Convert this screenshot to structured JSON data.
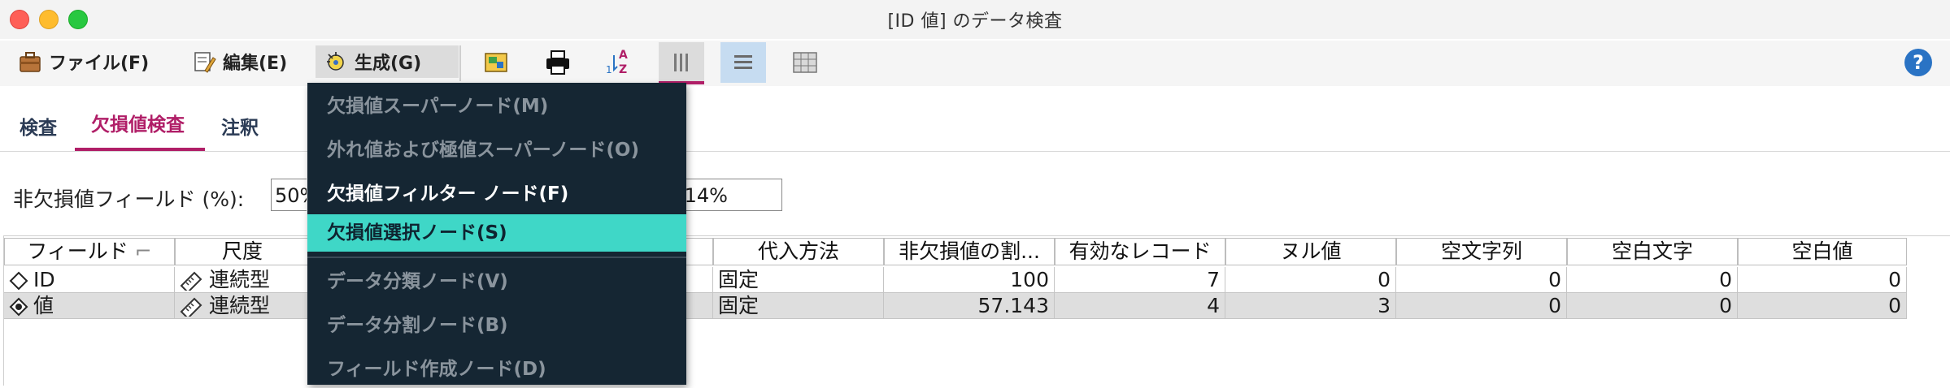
{
  "window": {
    "title": "[ID 値] のデータ検査"
  },
  "menubar": {
    "items": [
      {
        "label": "ファイル(F)",
        "icon": "briefcase-icon"
      },
      {
        "label": "編集(E)",
        "icon": "edit-icon"
      },
      {
        "label": "生成(G)",
        "icon": "generate-icon"
      }
    ],
    "toolbar": [
      "data-audit-icon",
      "print-icon",
      "sort-icon",
      "columns-icon",
      "rows-icon",
      "grid-icon"
    ],
    "help": "?"
  },
  "tabs": [
    "検査",
    "欠損値検査",
    "注釈"
  ],
  "completeness": {
    "label": "非欠損値フィールド (%):",
    "value": "50%",
    "value2": ".14%"
  },
  "table": {
    "headers": [
      "フィールド",
      "尺度",
      "",
      "",
      "代入方法",
      "非欠損値の割...",
      "有効なレコード",
      "ヌル値",
      "空文字列",
      "空白文字",
      "空白値"
    ],
    "rows": [
      {
        "field": "ID",
        "field_icon": "diamond-icon",
        "measure": "連続型",
        "measure_icon": "ruler-icon",
        "method": "固定",
        "pct": "100",
        "valid": "7",
        "null": "0",
        "empty_string": "0",
        "whitespace": "0",
        "blank": "0"
      },
      {
        "field": "値",
        "field_icon": "diamond-dot-icon",
        "measure": "連続型",
        "measure_icon": "ruler-icon",
        "method": "固定",
        "pct": "57.143",
        "valid": "4",
        "null": "3",
        "empty_string": "0",
        "whitespace": "0",
        "blank": "0"
      }
    ]
  },
  "dropdown": {
    "items": [
      {
        "label": "欠損値スーパーノード(M)",
        "state": "disabled"
      },
      {
        "label": "外れ値および極値スーパーノード(O)",
        "state": "disabled"
      },
      {
        "label": "欠損値フィルター ノード(F)",
        "state": "enabled"
      },
      {
        "label": "欠損値選択ノード(S)",
        "state": "highlighted"
      },
      {
        "label": "データ分類ノード(V)",
        "state": "disabled"
      },
      {
        "label": "データ分割ノード(B)",
        "state": "disabled"
      },
      {
        "label": "フィールド作成ノード(D)",
        "state": "disabled"
      }
    ]
  },
  "colors": {
    "accent": "#b01e67",
    "menu_bg": "#152633",
    "highlight": "#3fd7c7"
  }
}
